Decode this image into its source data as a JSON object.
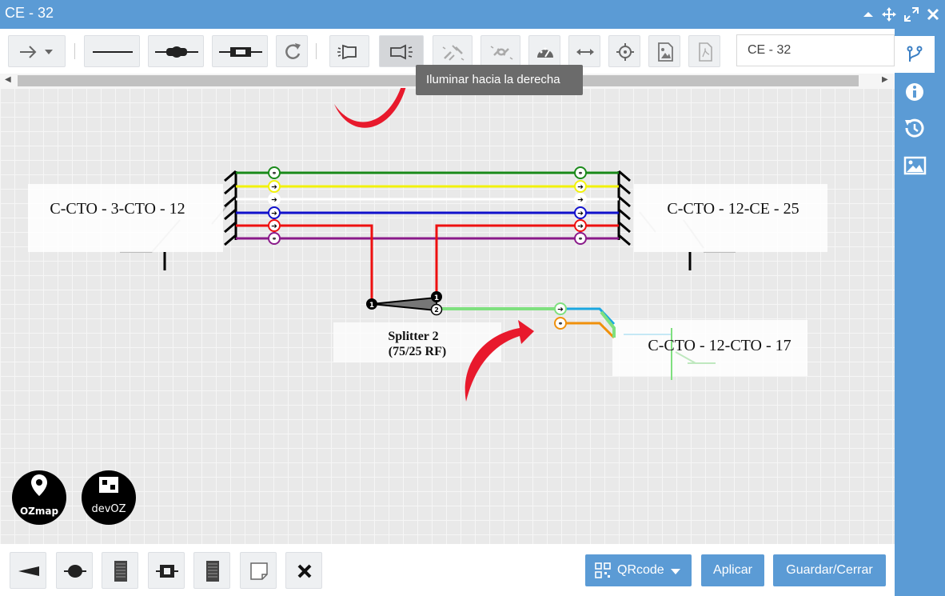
{
  "window": {
    "title": "CE - 32"
  },
  "toolbar": {
    "name_field_value": "CE - 32"
  },
  "tooltip": {
    "text": "Iluminar hacia la derecha"
  },
  "diagram": {
    "left_box_label": "C-CTO - 3-CTO - 12",
    "right_box_label": "C-CTO - 12-CE - 25",
    "lower_box_label": "C-CTO - 12-CTO - 17",
    "splitter_name": "Splitter 2",
    "splitter_ratio": "(75/25 RF)",
    "splitter_in_port": "1",
    "splitter_out_port_1": "1",
    "splitter_out_port_2": "2",
    "fiber_colors": [
      "#1a8a1a",
      "#f2f20a",
      "#ffffff",
      "#1010cc",
      "#ee1010",
      "#8a1a8a"
    ],
    "out_fiber_colors": [
      "#7fe07f",
      "#1aa7e0",
      "#f0900a"
    ]
  },
  "logos": {
    "ozmap_text": "OZmap",
    "devoz_text": "devOZ"
  },
  "bottombar": {
    "qrcode_label": "QRcode",
    "apply_label": "Aplicar",
    "save_close_label": "Guardar/Cerrar"
  },
  "colors": {
    "accent": "#5b9bd5",
    "arrow_annotation": "#e8192c"
  }
}
